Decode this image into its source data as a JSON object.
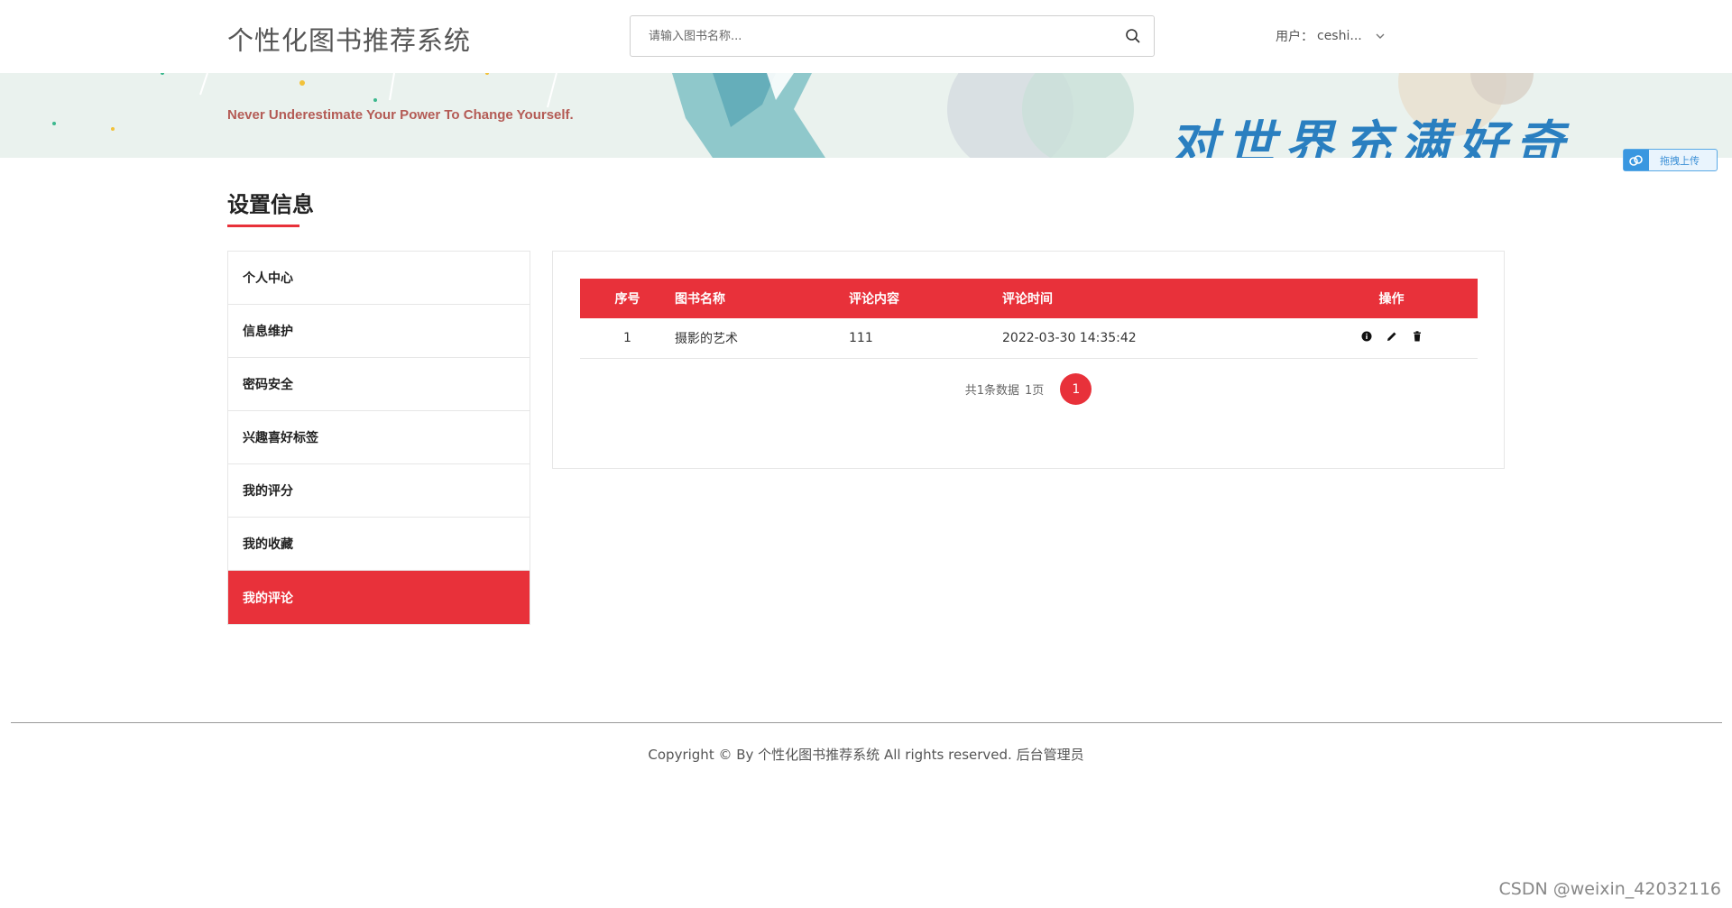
{
  "header": {
    "site_title": "个性化图书推荐系统",
    "search_placeholder": "请输入图书名称...",
    "user_label": "用户：",
    "user_name": "ceshi..."
  },
  "banner": {
    "tagline": "Never Underestimate Your Power To Change Yourself.",
    "slogan": "对世界充满好奇",
    "upload_badge": "拖拽上传"
  },
  "section": {
    "title": "设置信息"
  },
  "side_menu": {
    "items": [
      {
        "label": "个人中心",
        "active": false
      },
      {
        "label": "信息维护",
        "active": false
      },
      {
        "label": "密码安全",
        "active": false
      },
      {
        "label": "兴趣喜好标签",
        "active": false
      },
      {
        "label": "我的评分",
        "active": false
      },
      {
        "label": "我的收藏",
        "active": false
      },
      {
        "label": "我的评论",
        "active": true
      }
    ]
  },
  "table": {
    "columns": [
      "序号",
      "图书名称",
      "评论内容",
      "评论时间",
      "操作"
    ],
    "rows": [
      {
        "index": "1",
        "book_name": "摄影的艺术",
        "content": "111",
        "time": "2022-03-30 14:35:42"
      }
    ],
    "actions": [
      "info-icon",
      "edit-icon",
      "delete-icon"
    ]
  },
  "pager": {
    "total_text": "共1条数据",
    "pages_text": "1页",
    "current_page": "1"
  },
  "footer": {
    "copyright": "Copyright © By 个性化图书推荐系统 All rights reserved. 后台管理员"
  },
  "watermark": "CSDN @weixin_42032116",
  "colors": {
    "accent": "#e8313a",
    "banner_bg": "#eaf2ee",
    "slogan": "#2a7fc0",
    "tagline": "#b45b55"
  }
}
